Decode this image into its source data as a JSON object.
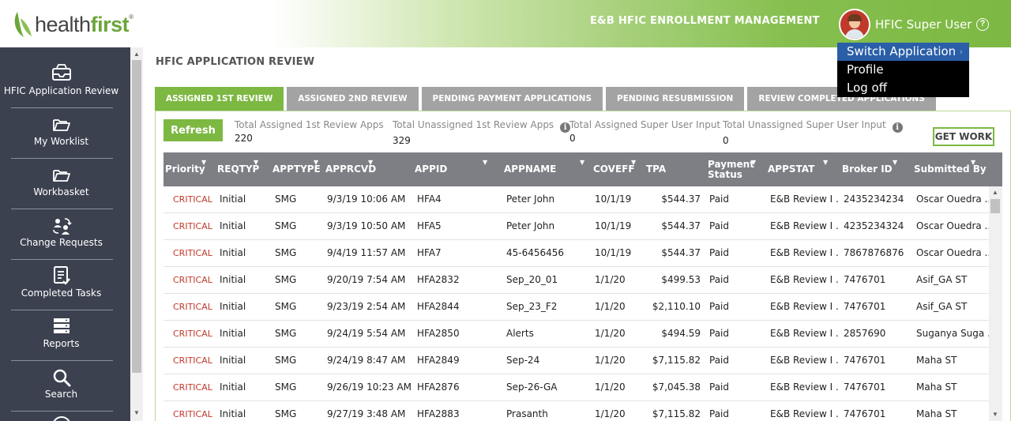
{
  "header": {
    "logo_part1": "health",
    "logo_part2": "first",
    "logo_tm": "®",
    "app_title": "E&B HFIC ENROLLMENT MANAGEMENT",
    "user_name": "HFIC Super User",
    "help_icon": "question-circle-icon",
    "help_glyph": "?"
  },
  "user_menu": {
    "items": [
      {
        "label": "Switch Application",
        "active": true,
        "chevron": "›"
      },
      {
        "label": "Profile"
      },
      {
        "label": "Log off"
      }
    ]
  },
  "sidebar": {
    "items": [
      {
        "label": "HFIC Application Review",
        "icon": "inbox-tray-icon"
      },
      {
        "label": "My Worklist",
        "icon": "folder-open-icon"
      },
      {
        "label": "Workbasket",
        "icon": "folder-open-icon"
      },
      {
        "label": "Change Requests",
        "icon": "people-exchange-icon"
      },
      {
        "label": "Completed Tasks",
        "icon": "document-check-icon"
      },
      {
        "label": "Reports",
        "icon": "server-stack-icon"
      },
      {
        "label": "Search",
        "icon": "search-icon"
      }
    ]
  },
  "main": {
    "page_title": "HFIC APPLICATION REVIEW",
    "tabs": [
      {
        "label": "ASSIGNED 1ST REVIEW",
        "active": true
      },
      {
        "label": "ASSIGNED 2ND REVIEW"
      },
      {
        "label": "PENDING PAYMENT APPLICATIONS"
      },
      {
        "label": "PENDING RESUBMISSION"
      },
      {
        "label": "REVIEW COMPLETED APPLICATIONS"
      }
    ],
    "refresh_label": "Refresh",
    "get_work_label": "GET WORK",
    "info_glyph": "i",
    "stats": [
      {
        "label": "Total Assigned 1st Review Apps",
        "value": "220"
      },
      {
        "label": "Total Unassigned 1st Review Apps",
        "value": "329",
        "info": true
      },
      {
        "label": "Total Assigned Super User Input",
        "value": "0"
      },
      {
        "label": "Total Unassigned Super User Input",
        "value": "0",
        "info": true
      }
    ]
  },
  "table": {
    "filter_glyph": "▼",
    "columns": [
      "Priority",
      "REQTYP",
      "APPTYPE",
      "APPRCVD",
      "APPID",
      "APPNAME",
      "COVEFF",
      "TPA",
      "Payment Status",
      "APPSTAT",
      "Broker ID",
      "Submitted By"
    ],
    "rows": [
      [
        "CRITICAL",
        "Initial",
        "SMG",
        "9/3/19 10:06 AM",
        "HFA4",
        "Peter John",
        "10/1/19",
        "$544.37",
        "Paid",
        "E&B Review I ...",
        "2435234234",
        "Oscar Ouedra ..."
      ],
      [
        "CRITICAL",
        "Initial",
        "SMG",
        "9/3/19 10:50 AM",
        "HFA5",
        "Peter John",
        "10/1/19",
        "$544.37",
        "Paid",
        "E&B Review I ...",
        "4235234324",
        "Oscar Ouedra ..."
      ],
      [
        "CRITICAL",
        "Initial",
        "SMG",
        "9/4/19 11:57 AM",
        "HFA7",
        "45-6456456",
        "10/1/19",
        "$544.37",
        "Paid",
        "E&B Review I ...",
        "7867876876",
        "Oscar Ouedra ..."
      ],
      [
        "CRITICAL",
        "Initial",
        "SMG",
        "9/20/19 7:54 AM",
        "HFA2832",
        "Sep_20_01",
        "1/1/20",
        "$499.53",
        "Paid",
        "E&B Review I ...",
        "7476701",
        "Asif_GA ST"
      ],
      [
        "CRITICAL",
        "Initial",
        "SMG",
        "9/23/19 2:54 AM",
        "HFA2844",
        "Sep_23_F2",
        "1/1/20",
        "$2,110.10",
        "Paid",
        "E&B Review I ...",
        "7476701",
        "Asif_GA ST"
      ],
      [
        "CRITICAL",
        "Initial",
        "SMG",
        "9/24/19 5:54 AM",
        "HFA2850",
        "Alerts",
        "1/1/20",
        "$494.59",
        "Paid",
        "E&B Review I ...",
        "2857690",
        "Suganya Suga ..."
      ],
      [
        "CRITICAL",
        "Initial",
        "SMG",
        "9/24/19 8:47 AM",
        "HFA2849",
        "Sep-24",
        "1/1/20",
        "$7,115.82",
        "Paid",
        "E&B Review I ...",
        "7476701",
        "Maha ST"
      ],
      [
        "CRITICAL",
        "Initial",
        "SMG",
        "9/26/19 10:23 AM",
        "HFA2876",
        "Sep-26-GA",
        "1/1/20",
        "$7,045.38",
        "Paid",
        "E&B Review I ...",
        "7476701",
        "Maha ST"
      ],
      [
        "CRITICAL",
        "Initial",
        "SMG",
        "9/27/19 3:48 AM",
        "HFA2883",
        "Prasanth",
        "1/1/20",
        "$7,115.82",
        "Paid",
        "E&B Review I ...",
        "7476701",
        "Maha ST"
      ]
    ]
  },
  "colors": {
    "brand_green": "#7cb842",
    "sidebar_bg": "#3c4150",
    "critical_red": "#c0392b",
    "menu_active": "#2a5fa8"
  }
}
